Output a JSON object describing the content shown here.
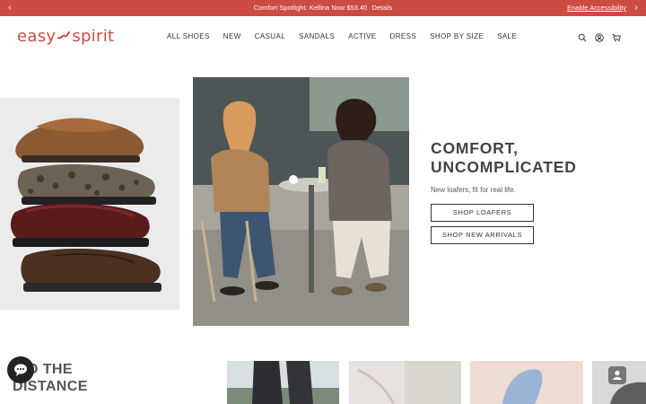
{
  "announcement": {
    "message": "Comfort Spotlight: Kellina Now $53.40",
    "details_link": "Details",
    "accessibility_link": "Enable Accessibility",
    "prev_glyph": "‹",
    "next_glyph": "›"
  },
  "brand": {
    "logo_left": "easy",
    "logo_right": "spirit",
    "accent_color": "#cc4b43"
  },
  "nav": {
    "items": [
      "ALL SHOES",
      "NEW",
      "CASUAL",
      "SANDALS",
      "ACTIVE",
      "DRESS",
      "SHOP BY SIZE",
      "SALE"
    ]
  },
  "header_icons": [
    "search-icon",
    "account-icon",
    "cart-icon"
  ],
  "hero": {
    "title_line1": "COMFORT,",
    "title_line2": "UNCOMPLICATED",
    "subtitle": "New loafers, fit for real life.",
    "button_primary": "SHOP LOAFERS",
    "button_secondary": "SHOP NEW ARRIVALS"
  },
  "section": {
    "title_line1": "O THE",
    "title_line2": "DISTANCE"
  }
}
